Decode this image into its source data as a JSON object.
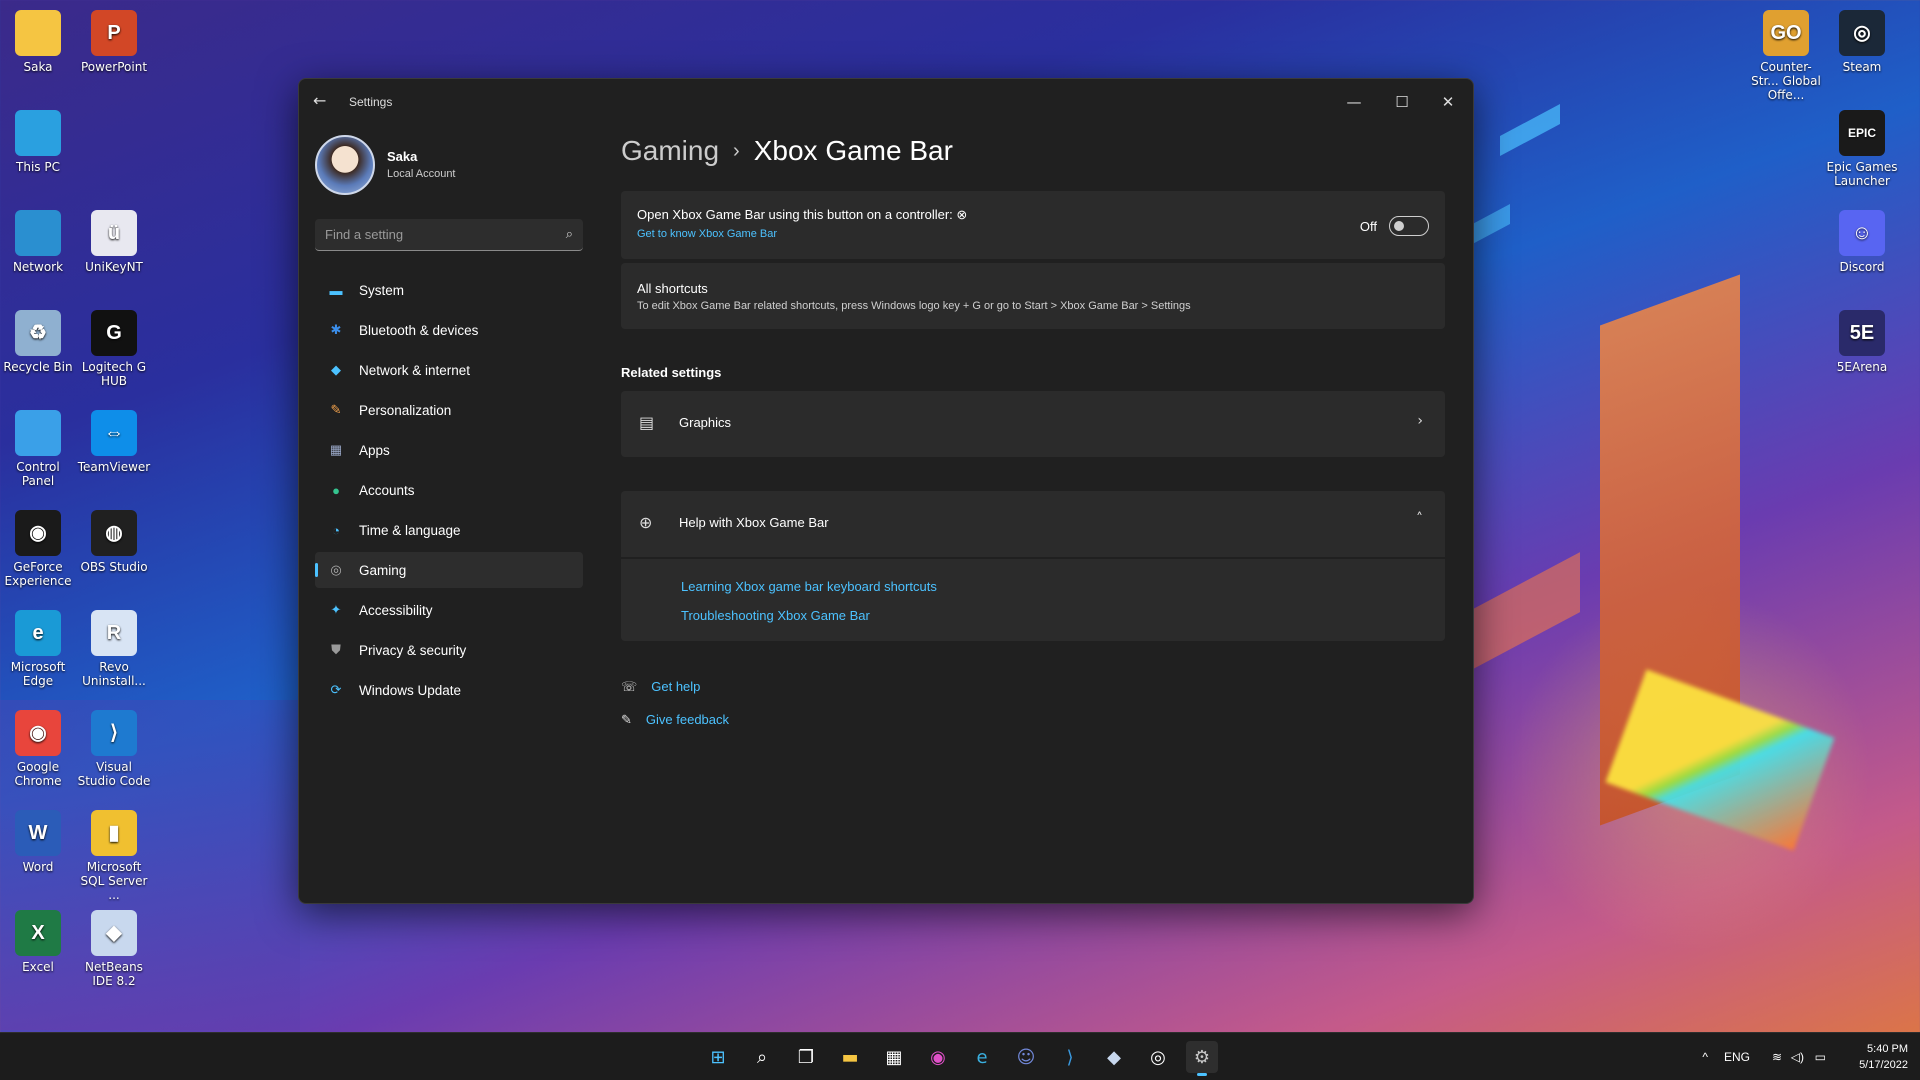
{
  "window": {
    "title": "Settings",
    "controls": {
      "minimize": "—",
      "maximize": "☐",
      "close": "✕"
    }
  },
  "profile": {
    "name": "Saka",
    "account": "Local Account"
  },
  "search": {
    "placeholder": "Find a setting"
  },
  "nav": [
    {
      "label": "System",
      "icon": "system-icon",
      "color": "#4cc2ff",
      "glyph": "▬"
    },
    {
      "label": "Bluetooth & devices",
      "icon": "bluetooth-icon",
      "color": "#3b8eea",
      "glyph": "✱"
    },
    {
      "label": "Network & internet",
      "icon": "wifi-icon",
      "color": "#4cc2ff",
      "glyph": "◆"
    },
    {
      "label": "Personalization",
      "icon": "brush-icon",
      "color": "#f0a04b",
      "glyph": "✎"
    },
    {
      "label": "Apps",
      "icon": "apps-icon",
      "color": "#9aa8c8",
      "glyph": "▦"
    },
    {
      "label": "Accounts",
      "icon": "accounts-icon",
      "color": "#35c48f",
      "glyph": "●"
    },
    {
      "label": "Time & language",
      "icon": "globe-clock-icon",
      "color": "#4cc2ff",
      "glyph": "◔"
    },
    {
      "label": "Gaming",
      "icon": "gamepad-icon",
      "color": "#b0b0b0",
      "glyph": "◎",
      "selected": true
    },
    {
      "label": "Accessibility",
      "icon": "accessibility-icon",
      "color": "#4cc2ff",
      "glyph": "✦"
    },
    {
      "label": "Privacy & security",
      "icon": "shield-icon",
      "color": "#9a9a9a",
      "glyph": "⛊"
    },
    {
      "label": "Windows Update",
      "icon": "update-icon",
      "color": "#4cc2ff",
      "glyph": "⟳"
    }
  ],
  "breadcrumb": {
    "parent": "Gaming",
    "separator": "›",
    "current": "Xbox Game Bar"
  },
  "controller_card": {
    "title": "Open Xbox Game Bar using this button on a controller:",
    "link": "Get to know Xbox Game Bar",
    "toggle_state": "Off",
    "toggle_on": false
  },
  "shortcuts_card": {
    "title": "All shortcuts",
    "subtitle": "To edit Xbox Game Bar related shortcuts, press Windows logo key + G or go to Start > Xbox Game Bar > Settings"
  },
  "related": {
    "heading": "Related settings",
    "graphics_label": "Graphics"
  },
  "help": {
    "title": "Help with Xbox Game Bar",
    "links": [
      "Learning Xbox game bar keyboard shortcuts",
      "Troubleshooting Xbox Game Bar"
    ]
  },
  "footer": {
    "get_help": "Get help",
    "give_feedback": "Give feedback"
  },
  "desktop_icons_left": [
    {
      "label": "Saka",
      "icon": "folder-icon",
      "bg": "#f5c542",
      "glyph": ""
    },
    {
      "label": "PowerPoint",
      "icon": "powerpoint-icon",
      "bg": "#d24726",
      "glyph": "P"
    },
    {
      "label": "This PC",
      "icon": "monitor-icon",
      "bg": "#2aa0e0",
      "glyph": ""
    },
    {
      "label": "",
      "icon": "blank-icon",
      "bg": "transparent",
      "glyph": ""
    },
    {
      "label": "Network",
      "icon": "network-icon",
      "bg": "#2a8fd0",
      "glyph": ""
    },
    {
      "label": "UniKeyNT",
      "icon": "unikey-icon",
      "bg": "#e8e8f0",
      "glyph": "ü"
    },
    {
      "label": "Recycle Bin",
      "icon": "recycle-bin-icon",
      "bg": "#8fb0d0",
      "glyph": "♻"
    },
    {
      "label": "Logitech G HUB",
      "icon": "logitech-icon",
      "bg": "#111111",
      "glyph": "G"
    },
    {
      "label": "Control Panel",
      "icon": "control-panel-icon",
      "bg": "#3aa0e8",
      "glyph": ""
    },
    {
      "label": "TeamViewer",
      "icon": "teamviewer-icon",
      "bg": "#0e8ee9",
      "glyph": "⇔"
    },
    {
      "label": "GeForce Experience",
      "icon": "nvidia-icon",
      "bg": "#1a1a1a",
      "glyph": "◉"
    },
    {
      "label": "OBS Studio",
      "icon": "obs-icon",
      "bg": "#202020",
      "glyph": "◍"
    },
    {
      "label": "Microsoft Edge",
      "icon": "edge-icon",
      "bg": "#1a9ad6",
      "glyph": "e"
    },
    {
      "label": "Revo Uninstall...",
      "icon": "revo-icon",
      "bg": "#d8e4f4",
      "glyph": "R"
    },
    {
      "label": "Google Chrome",
      "icon": "chrome-icon",
      "bg": "#e8453c",
      "glyph": "◉"
    },
    {
      "label": "Visual Studio Code",
      "icon": "vscode-icon",
      "bg": "#1e7ad0",
      "glyph": "⟩"
    },
    {
      "label": "Word",
      "icon": "word-icon",
      "bg": "#2b5cb8",
      "glyph": "W"
    },
    {
      "label": "Microsoft SQL Server ...",
      "icon": "sql-server-icon",
      "bg": "#f0c030",
      "glyph": "▮"
    },
    {
      "label": "Excel",
      "icon": "excel-icon",
      "bg": "#1f7a45",
      "glyph": "X"
    },
    {
      "label": "NetBeans IDE 8.2",
      "icon": "netbeans-icon",
      "bg": "#c8d8ee",
      "glyph": "◆"
    }
  ],
  "desktop_icons_right": [
    {
      "label": "Counter-Str... Global Offe...",
      "icon": "csgo-icon",
      "bg": "#e0a030",
      "glyph": "GO"
    },
    {
      "label": "Steam",
      "icon": "steam-icon",
      "bg": "#1b2838",
      "glyph": "◎"
    },
    {
      "label": "Epic Games Launcher",
      "icon": "epic-games-icon",
      "bg": "#1a1a1a",
      "glyph": "EPIC"
    },
    {
      "label": "Discord",
      "icon": "discord-icon",
      "bg": "#5865f2",
      "glyph": "☺"
    },
    {
      "label": "5EArena",
      "icon": "5earena-icon",
      "bg": "#2a2a6a",
      "glyph": "5E"
    }
  ],
  "taskbar": {
    "apps": [
      {
        "name": "start-icon",
        "glyph": "⊞",
        "color": "#4cc2ff"
      },
      {
        "name": "search-icon",
        "glyph": "⌕",
        "color": "#ffffff"
      },
      {
        "name": "task-view-icon",
        "glyph": "❐",
        "color": "#ffffff"
      },
      {
        "name": "file-explorer-icon",
        "glyph": "▬",
        "color": "#f5c542"
      },
      {
        "name": "store-icon",
        "glyph": "▦",
        "color": "#ffffff"
      },
      {
        "name": "media-app-icon",
        "glyph": "◉",
        "color": "#e050c8"
      },
      {
        "name": "edge-icon",
        "glyph": "e",
        "color": "#3ab0e0"
      },
      {
        "name": "discord-icon",
        "glyph": "☺",
        "color": "#7289da"
      },
      {
        "name": "vscode-icon",
        "glyph": "⟩",
        "color": "#3a9ae0"
      },
      {
        "name": "cube-app-icon",
        "glyph": "◆",
        "color": "#c8d8ee"
      },
      {
        "name": "steam-icon",
        "glyph": "◎",
        "color": "#ffffff"
      },
      {
        "name": "settings-icon",
        "glyph": "⚙",
        "color": "#c8c8c8",
        "active": true
      }
    ],
    "tray": {
      "chevron": "^",
      "language": "ENG",
      "wifi": "≋",
      "volume": "◁)",
      "battery": "▭"
    },
    "time": "5:40 PM",
    "date": "5/17/2022"
  }
}
